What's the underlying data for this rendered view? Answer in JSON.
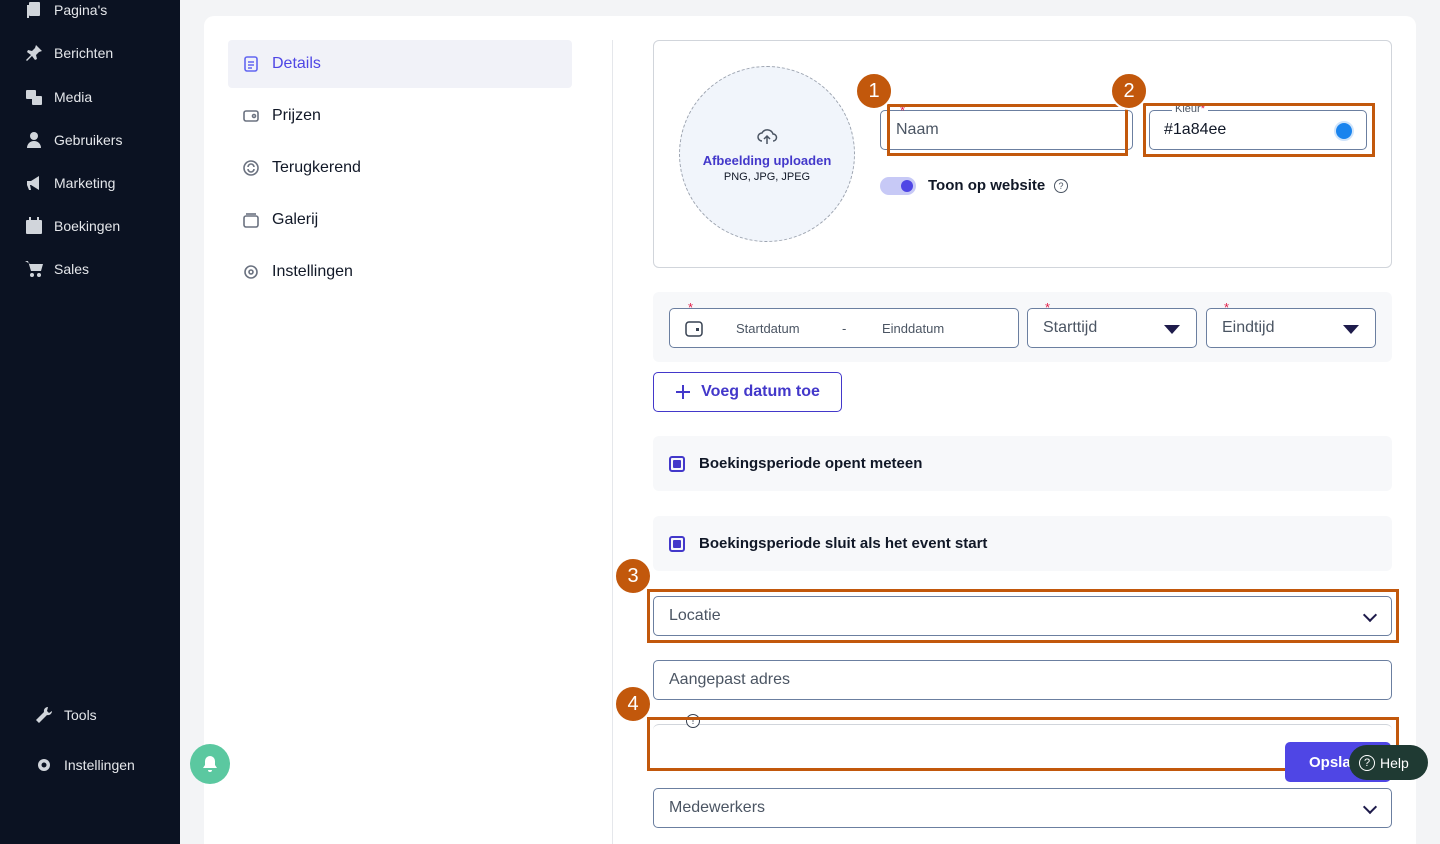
{
  "sidebar": {
    "items": [
      {
        "label": "Pagina's",
        "icon": "pages-icon"
      },
      {
        "label": "Berichten",
        "icon": "pin-icon"
      },
      {
        "label": "Media",
        "icon": "media-icon"
      },
      {
        "label": "Gebruikers",
        "icon": "user-icon"
      },
      {
        "label": "Marketing",
        "icon": "megaphone-icon"
      },
      {
        "label": "Boekingen",
        "icon": "calendar-icon"
      },
      {
        "label": "Sales",
        "icon": "cart-icon"
      }
    ],
    "bottom": [
      {
        "label": "Tools",
        "icon": "wrench-icon"
      },
      {
        "label": "Instellingen",
        "icon": "gear-icon"
      }
    ]
  },
  "subnav": {
    "items": [
      {
        "label": "Details",
        "icon": "document-icon",
        "active": true
      },
      {
        "label": "Prijzen",
        "icon": "wallet-icon"
      },
      {
        "label": "Terugkerend",
        "icon": "repeat-icon"
      },
      {
        "label": "Galerij",
        "icon": "gallery-icon"
      },
      {
        "label": "Instellingen",
        "icon": "settings-icon"
      }
    ]
  },
  "form": {
    "upload": {
      "title": "Afbeelding uploaden",
      "subtitle": "PNG, JPG, JPEG"
    },
    "name": {
      "placeholder": "Naam",
      "required_mark": "*"
    },
    "color": {
      "label": "Kleur",
      "value": "#1a84ee",
      "required_mark": "*",
      "swatch": "#1a84ee"
    },
    "show_on_website": {
      "label": "Toon op website",
      "on": true
    },
    "date": {
      "start_placeholder": "Startdatum",
      "separator": "-",
      "end_placeholder": "Einddatum",
      "required_mark": "*"
    },
    "start_time": {
      "placeholder": "Starttijd",
      "required_mark": "*"
    },
    "end_time": {
      "placeholder": "Eindtijd",
      "required_mark": "*"
    },
    "add_date": {
      "label": "Voeg datum toe",
      "icon": "plus-icon"
    },
    "booking_opens": {
      "label": "Boekingsperiode opent meteen",
      "checked": true
    },
    "booking_closes": {
      "label": "Boekingsperiode sluit als het event start",
      "checked": true
    },
    "location": {
      "placeholder": "Locatie"
    },
    "custom_address": {
      "placeholder": "Aangepast adres"
    },
    "staff": {
      "placeholder": "Medewerkers"
    }
  },
  "actions": {
    "save_label": "Opsla",
    "help_label": "Help",
    "help_icon_glyph": "?"
  },
  "annotations": [
    "1",
    "2",
    "3",
    "4"
  ],
  "colors": {
    "accent": "#4f46e5",
    "highlight": "#c2580c",
    "sidebar": "#0b1222"
  }
}
